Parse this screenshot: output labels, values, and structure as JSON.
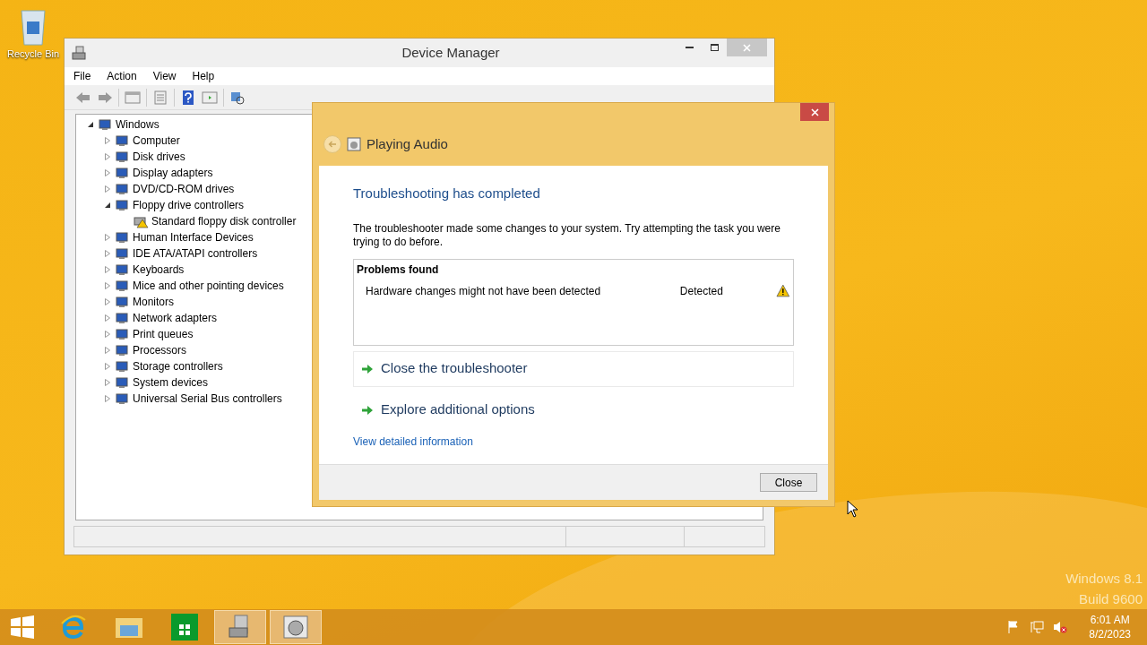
{
  "desktop": {
    "icons": [
      {
        "label": "Recycle Bin"
      }
    ],
    "watermark_lines": [
      "Windows 8.1",
      "Build 9600"
    ]
  },
  "device_manager": {
    "title": "Device Manager",
    "menu": [
      "File",
      "Action",
      "View",
      "Help"
    ],
    "tree": [
      {
        "label": "Windows",
        "expanded": true,
        "children": [
          {
            "label": "Computer",
            "expanded": false
          },
          {
            "label": "Disk drives",
            "expanded": false
          },
          {
            "label": "Display adapters",
            "expanded": false
          },
          {
            "label": "DVD/CD-ROM drives",
            "expanded": false
          },
          {
            "label": "Floppy drive controllers",
            "expanded": true,
            "children": [
              {
                "label": "Standard floppy disk controller",
                "warning": true
              }
            ]
          },
          {
            "label": "Human Interface Devices",
            "expanded": false
          },
          {
            "label": "IDE ATA/ATAPI controllers",
            "expanded": false
          },
          {
            "label": "Keyboards",
            "expanded": false
          },
          {
            "label": "Mice and other pointing devices",
            "expanded": false
          },
          {
            "label": "Monitors",
            "expanded": false
          },
          {
            "label": "Network adapters",
            "expanded": false
          },
          {
            "label": "Print queues",
            "expanded": false
          },
          {
            "label": "Processors",
            "expanded": false
          },
          {
            "label": "Storage controllers",
            "expanded": false
          },
          {
            "label": "System devices",
            "expanded": false
          },
          {
            "label": "Universal Serial Bus controllers",
            "expanded": false
          }
        ]
      }
    ]
  },
  "troubleshooter": {
    "title": "Playing Audio",
    "heading": "Troubleshooting has completed",
    "message": "The troubleshooter made some changes to your system. Try attempting the task you were trying to do before.",
    "problems": {
      "heading": "Problems found",
      "rows": [
        {
          "problem": "Hardware changes might not have been detected",
          "status": "Detected"
        }
      ]
    },
    "actions": [
      {
        "label": "Close the troubleshooter",
        "selected": true
      },
      {
        "label": "Explore additional options",
        "selected": false
      }
    ],
    "link": "View detailed information",
    "button": "Close"
  },
  "taskbar": {
    "apps": [
      {
        "kind": "ie",
        "selected": false
      },
      {
        "kind": "explorer",
        "selected": false
      },
      {
        "kind": "store",
        "selected": false
      },
      {
        "kind": "devmgr",
        "selected": true
      },
      {
        "kind": "troubleshooter",
        "selected": true
      }
    ],
    "time": "6:01 AM",
    "date": "8/2/2023"
  }
}
